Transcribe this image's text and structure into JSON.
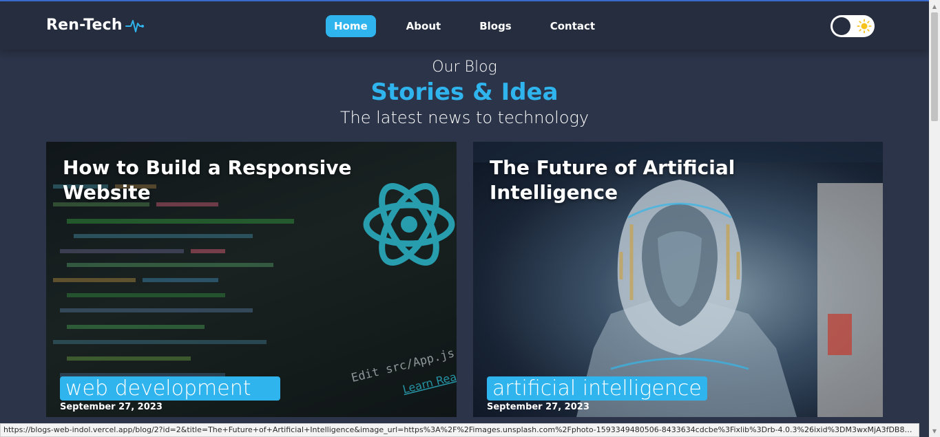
{
  "brand": {
    "name": "Ren-Tech",
    "icon": "pulse-icon"
  },
  "nav": {
    "items": [
      {
        "label": "Home",
        "active": true
      },
      {
        "label": "About",
        "active": false
      },
      {
        "label": "Blogs",
        "active": false
      },
      {
        "label": "Contact",
        "active": false
      }
    ]
  },
  "theme_toggle": {
    "icon": "sun-icon",
    "mode": "dark"
  },
  "hero": {
    "eyebrow": "Our Blog",
    "title": "Stories & Idea",
    "subtitle": "The latest news to technology"
  },
  "posts": [
    {
      "title": "How to Build a Responsive Website",
      "tag": "web development",
      "date": "September 27, 2023",
      "image": "react-code-editor"
    },
    {
      "title": "The Future of Artificial Intelligence",
      "tag": "artificial intelligence",
      "date": "September 27, 2023",
      "image": "chrome-robot"
    }
  ],
  "colors": {
    "accent": "#2fb4ee",
    "background": "#2b3448",
    "navbar": "#252d3e"
  },
  "status_url": "https://blogs-web-indol.vercel.app/blog/2?id=2&title=The+Future+of+Artificial+Intelligence&image_url=https%3A%2F%2Fimages.unsplash.com%2Fphoto-1593349480506-8433634cdcbe%3Fixlib%3Drb-4.0.3%26ixid%3DM3wxMjA3fDB8MHxwaG90b..."
}
